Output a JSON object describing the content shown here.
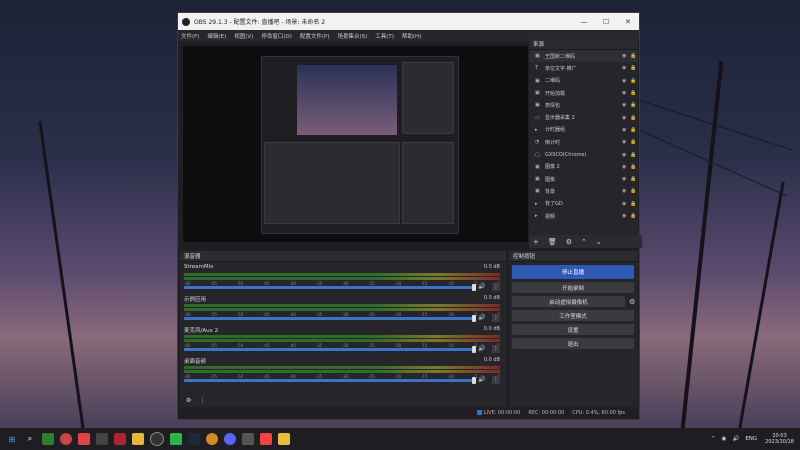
{
  "window": {
    "title": "OBS 29.1.3 - 配置文件: 直播吧 - 场景: 未命名 2",
    "menu": [
      "文件(F)",
      "编辑(E)",
      "视图(V)",
      "停靠窗口(D)",
      "配置文件(P)",
      "场景集合(S)",
      "工具(T)",
      "帮助(H)"
    ]
  },
  "sources": {
    "header": "来源",
    "items": [
      {
        "name": "王国新二维码",
        "icon": "image-icon"
      },
      {
        "name": "单位文字·推广",
        "icon": "text-icon"
      },
      {
        "name": "二维码",
        "icon": "image-icon"
      },
      {
        "name": "开始加载",
        "icon": "image-icon"
      },
      {
        "name": "表情包",
        "icon": "image-icon"
      },
      {
        "name": "显示器采集 2",
        "icon": "monitor-icon"
      },
      {
        "name": "计时器组",
        "icon": "folder-icon"
      },
      {
        "name": "倒计时",
        "icon": "clock-icon"
      },
      {
        "name": "GXSCO(Chrome)",
        "icon": "window-icon"
      },
      {
        "name": "图像 2",
        "icon": "image-icon"
      },
      {
        "name": "图像",
        "icon": "image-icon"
      },
      {
        "name": "背景",
        "icon": "image-icon"
      },
      {
        "name": "背了GD",
        "icon": "folder-icon"
      },
      {
        "name": "视频",
        "icon": "folder-icon"
      }
    ]
  },
  "mixer": {
    "header": "混音器",
    "ticks": [
      "-60",
      "-55",
      "-50",
      "-45",
      "-40",
      "-35",
      "-30",
      "-25",
      "-20",
      "-15",
      "-10",
      "-5",
      "0"
    ],
    "tracks": [
      {
        "name": "StreamMix",
        "db": "0.0 dB"
      },
      {
        "name": "示例应用",
        "db": "0.0 dB"
      },
      {
        "name": "麦克风/Aux 2",
        "db": "0.0 dB"
      },
      {
        "name": "桌面音频",
        "db": "0.0 dB"
      }
    ]
  },
  "controls": {
    "header": "控制按钮",
    "stop_stream": "停止直播",
    "start_record": "开始录制",
    "virtual_cam": "启动虚拟摄像机",
    "studio_mode": "工作室模式",
    "settings": "设置",
    "exit": "退出"
  },
  "status": {
    "live": "LIVE: 00:00:00",
    "rec": "REC: 00:00:00",
    "cpu": "CPU: 0.4%, 60.00 fps"
  },
  "taskbar": {
    "lang": "ENG",
    "time": "20:03",
    "date": "2023/10/18"
  },
  "colors": {
    "accent": "#2f5bb7",
    "panel": "#25252a"
  }
}
